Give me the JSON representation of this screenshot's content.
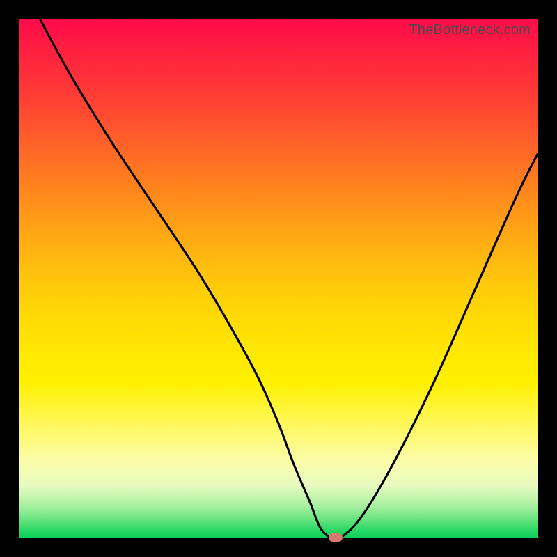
{
  "watermark": "TheBottleneck.com",
  "chart_data": {
    "type": "line",
    "title": "",
    "xlabel": "",
    "ylabel": "",
    "xlim": [
      0,
      100
    ],
    "ylim": [
      0,
      100
    ],
    "x": [
      4,
      10,
      18,
      26,
      34,
      40,
      46,
      50,
      53,
      56,
      58,
      60,
      62,
      66,
      72,
      80,
      88,
      96,
      100
    ],
    "values": [
      100,
      89,
      76,
      64,
      52,
      42,
      31,
      22,
      14,
      7,
      2,
      0,
      0,
      4,
      14,
      30,
      48,
      66,
      74
    ],
    "marker": {
      "x": 61,
      "y": 0
    },
    "gradient_stops": [
      {
        "pos": 0,
        "color": "#ff0a4a"
      },
      {
        "pos": 50,
        "color": "#ffd400"
      },
      {
        "pos": 85,
        "color": "#fff85a"
      },
      {
        "pos": 100,
        "color": "#0fce58"
      }
    ]
  }
}
